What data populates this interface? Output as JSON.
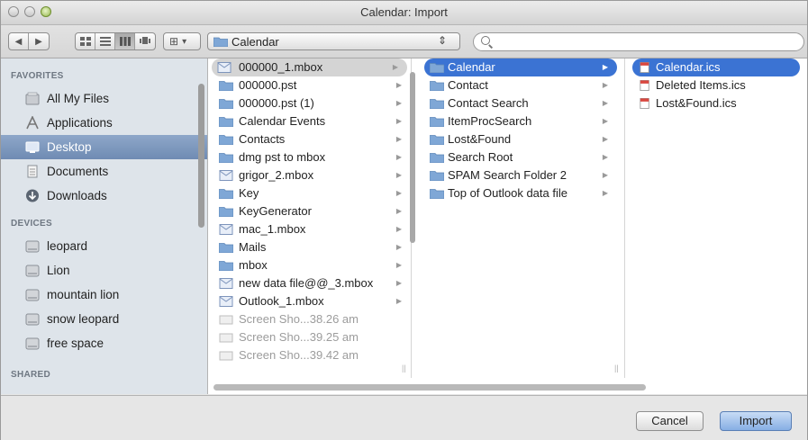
{
  "window": {
    "title": "Calendar: Import"
  },
  "toolbar": {
    "back": "◀",
    "forward": "▶",
    "view_icon": "⊞",
    "view_arrow": "▾",
    "location": "Calendar",
    "location_arrows": "⇕"
  },
  "sidebar": {
    "favorites_header": "FAVORITES",
    "favorites": [
      {
        "label": "All My Files"
      },
      {
        "label": "Applications"
      },
      {
        "label": "Desktop"
      },
      {
        "label": "Documents"
      },
      {
        "label": "Downloads"
      }
    ],
    "devices_header": "DEVICES",
    "devices": [
      {
        "label": "leopard"
      },
      {
        "label": "Lion"
      },
      {
        "label": "mountain lion"
      },
      {
        "label": "snow leopard"
      },
      {
        "label": "free space"
      }
    ],
    "shared_header": "SHARED"
  },
  "columns": {
    "col1": [
      {
        "label": "000000_1.mbox",
        "icon": "mbox-icon"
      },
      {
        "label": "000000.pst",
        "icon": "folder-icon"
      },
      {
        "label": "000000.pst (1)",
        "icon": "folder-icon"
      },
      {
        "label": "Calendar Events",
        "icon": "folder-icon"
      },
      {
        "label": "Contacts",
        "icon": "folder-icon"
      },
      {
        "label": "dmg pst to mbox",
        "icon": "folder-icon"
      },
      {
        "label": "grigor_2.mbox",
        "icon": "mbox-icon"
      },
      {
        "label": "Key",
        "icon": "folder-icon"
      },
      {
        "label": "KeyGenerator",
        "icon": "folder-icon"
      },
      {
        "label": "mac_1.mbox",
        "icon": "mbox-icon"
      },
      {
        "label": "Mails",
        "icon": "folder-icon"
      },
      {
        "label": "mbox",
        "icon": "folder-icon"
      },
      {
        "label": "new data file@@_3.mbox",
        "icon": "mbox-icon"
      },
      {
        "label": "Outlook_1.mbox",
        "icon": "mbox-icon"
      },
      {
        "label": "Screen Sho...38.26 am",
        "icon": "image-icon"
      },
      {
        "label": "Screen Sho...39.25 am",
        "icon": "image-icon"
      },
      {
        "label": "Screen Sho...39.42 am",
        "icon": "image-icon"
      }
    ],
    "col2": [
      {
        "label": "Calendar"
      },
      {
        "label": "Contact"
      },
      {
        "label": "Contact Search"
      },
      {
        "label": "ItemProcSearch"
      },
      {
        "label": "Lost&Found"
      },
      {
        "label": "Search Root"
      },
      {
        "label": "SPAM Search Folder 2"
      },
      {
        "label": "Top of Outlook data file"
      }
    ],
    "col3": [
      {
        "label": "Calendar.ics"
      },
      {
        "label": "Deleted Items.ics"
      },
      {
        "label": "Lost&Found.ics"
      }
    ],
    "arrow": "▶",
    "resize": "||"
  },
  "footer": {
    "cancel": "Cancel",
    "import": "Import"
  },
  "colors": {
    "selection": "#3b73d3",
    "folder": "#7fa7d6",
    "sidebar_bg": "#dee4ea"
  }
}
